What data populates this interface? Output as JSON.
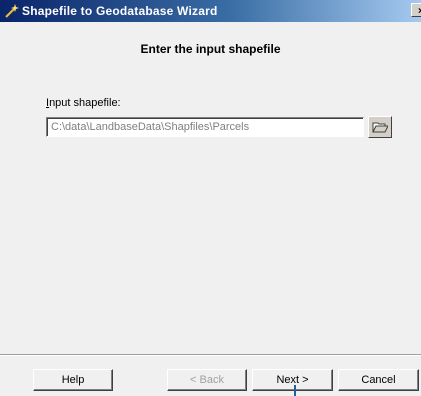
{
  "window": {
    "title": "Shapefile to Geodatabase Wizard",
    "close_label": "×",
    "app_icon": "wand-icon"
  },
  "page": {
    "heading": "Enter the input shapefile"
  },
  "input_shapefile": {
    "label_access_key": "I",
    "label_rest": "nput shapefile:",
    "value": "C:\\data\\LandbaseData\\Shapfiles\\Parcels",
    "browse_icon": "open-folder-icon"
  },
  "buttons": {
    "help": "Help",
    "back": "< Back",
    "next": "Next >",
    "cancel": "Cancel"
  },
  "colors": {
    "titlebar_start": "#0a246a",
    "titlebar_end": "#a6caf0",
    "pointer": "#1f5fa0"
  }
}
